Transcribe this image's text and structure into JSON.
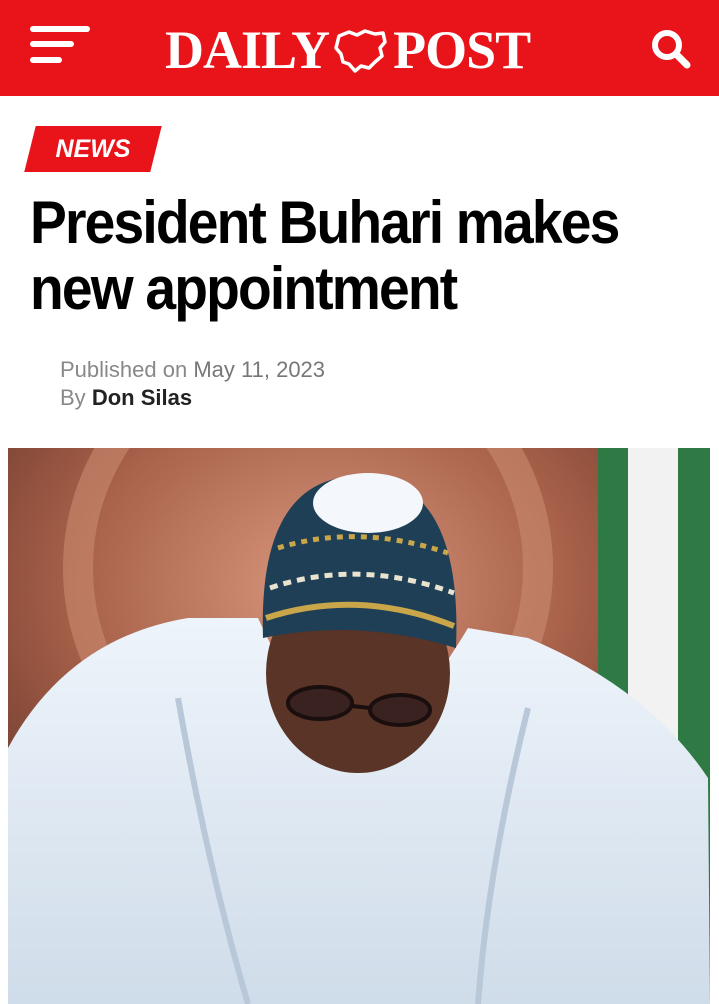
{
  "header": {
    "brand_left": "DAILY",
    "brand_right": "POST",
    "menu_icon": "hamburger-menu-icon",
    "search_icon": "search-icon",
    "brand_color": "#e8141a"
  },
  "article": {
    "category": "NEWS",
    "title": "President Buhari makes new appointment",
    "published_prefix": "Published on",
    "published_date": "May 11, 2023",
    "by_prefix": "By",
    "author": "Don Silas",
    "image_subject": "man in white attire and patterned cap looking down"
  }
}
